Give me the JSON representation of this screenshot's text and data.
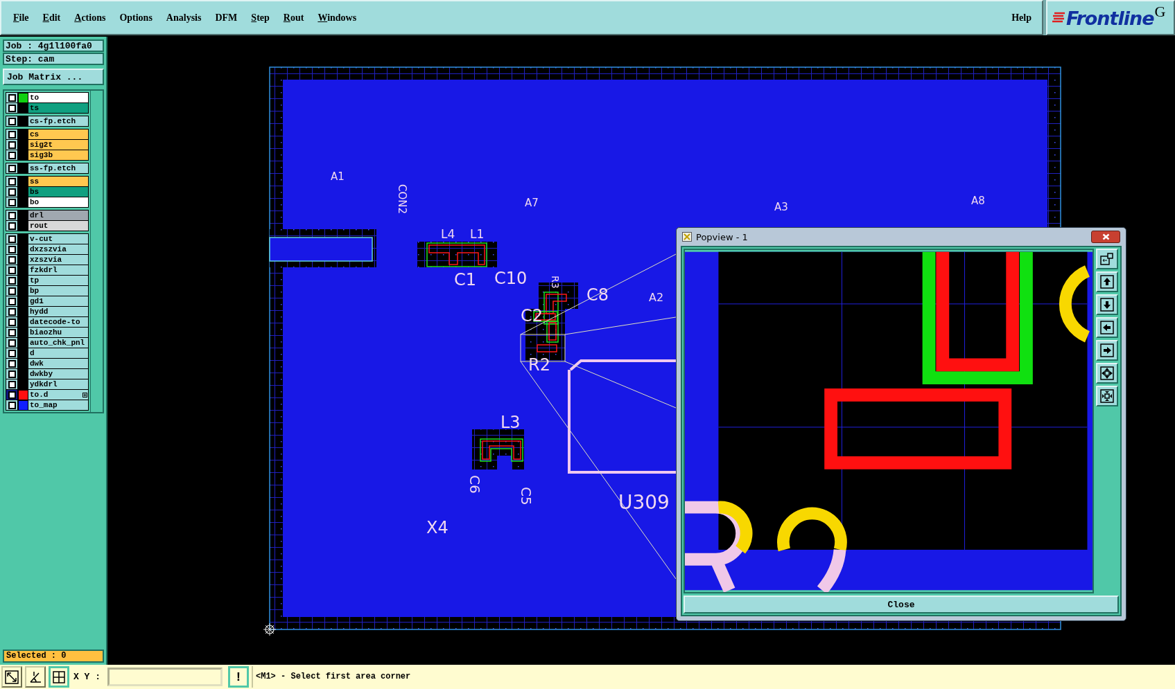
{
  "menu": [
    {
      "label": "File",
      "underlined": true
    },
    {
      "label": "Edit",
      "underlined": true
    },
    {
      "label": "Actions",
      "underlined": true
    },
    {
      "label": "Options",
      "underlined": false
    },
    {
      "label": "Analysis",
      "underlined": false
    },
    {
      "label": "DFM",
      "underlined": false
    },
    {
      "label": "Step",
      "underlined": true
    },
    {
      "label": "Rout",
      "underlined": true
    },
    {
      "label": "Windows",
      "underlined": true
    }
  ],
  "help": "Help",
  "logo": {
    "name": "Frontline",
    "suffix": "G"
  },
  "job": {
    "job": "Job : 4g1l100fa0",
    "step": "Step: cam",
    "matrix_button": "Job Matrix ..."
  },
  "layer_groups": [
    [
      {
        "name": "to",
        "color": "#ffffff",
        "swatch": {
          "color": "#10d010"
        },
        "selected": false
      },
      {
        "name": "ts",
        "color": "#10a080",
        "selected": false
      }
    ],
    [
      {
        "name": "cs-fp.etch",
        "color": "#a0dcdc",
        "selected": false
      }
    ],
    [
      {
        "name": "cs",
        "color": "#ffc850",
        "selected": false
      },
      {
        "name": "sig2t",
        "color": "#ffc850",
        "selected": false
      },
      {
        "name": "sig3b",
        "color": "#ffc850",
        "selected": false
      }
    ],
    [
      {
        "name": "ss-fp.etch",
        "color": "#a0dcdc",
        "selected": false
      }
    ],
    [
      {
        "name": "ss",
        "color": "#ffc850",
        "selected": false
      },
      {
        "name": "bs",
        "color": "#10a080",
        "selected": false
      },
      {
        "name": "bo",
        "color": "#ffffff",
        "selected": false
      }
    ],
    [
      {
        "name": "drl",
        "color": "#a0a8b0",
        "selected": false
      },
      {
        "name": "rout",
        "color": "#d8d8d8",
        "selected": false
      }
    ],
    [
      {
        "name": "v-cut",
        "color": "#a0dcdc",
        "selected": false
      },
      {
        "name": "dxzszvia",
        "color": "#a0dcdc",
        "selected": false
      },
      {
        "name": "xzszvia",
        "color": "#a0dcdc",
        "selected": false
      },
      {
        "name": "fzkdrl",
        "color": "#a0dcdc",
        "selected": false
      },
      {
        "name": "tp",
        "color": "#a0dcdc",
        "selected": false
      },
      {
        "name": "bp",
        "color": "#a0dcdc",
        "selected": false
      },
      {
        "name": "gd1",
        "color": "#a0dcdc",
        "selected": false
      },
      {
        "name": "hydd",
        "color": "#a0dcdc",
        "selected": false
      },
      {
        "name": "datecode-to",
        "color": "#a0dcdc",
        "selected": false
      },
      {
        "name": "biaozhu",
        "color": "#a0dcdc",
        "selected": false
      },
      {
        "name": "auto_chk_pnl",
        "color": "#a0dcdc",
        "selected": false
      },
      {
        "name": "d",
        "color": "#a0dcdc",
        "selected": false
      },
      {
        "name": "dwk",
        "color": "#a0dcdc",
        "selected": false
      },
      {
        "name": "dwkby",
        "color": "#a0dcdc",
        "selected": false
      },
      {
        "name": "ydkdrl",
        "color": "#a0dcdc",
        "selected": false
      },
      {
        "name": "to.d",
        "color": "#a0dcdc",
        "swatch": {
          "color": "#ff1010"
        },
        "selected": true
      },
      {
        "name": "to_map",
        "color": "#a0dcdc",
        "swatch": {
          "color": "#1020ff"
        },
        "selected": false
      }
    ]
  ],
  "selected_count": "Selected : 0",
  "board": {
    "labels": [
      {
        "text": "A1"
      },
      {
        "text": "CON2"
      },
      {
        "text": "A7"
      },
      {
        "text": "A3"
      },
      {
        "text": "A8"
      },
      {
        "text": "L4"
      },
      {
        "text": "L1"
      },
      {
        "text": "C1"
      },
      {
        "text": "C10"
      },
      {
        "text": "R3"
      },
      {
        "text": "C8"
      },
      {
        "text": "A2"
      },
      {
        "text": "C2"
      },
      {
        "text": "R2"
      },
      {
        "text": "L3"
      },
      {
        "text": "C6"
      },
      {
        "text": "C5"
      },
      {
        "text": "U309"
      },
      {
        "text": "X4"
      }
    ]
  },
  "popview": {
    "title": "Popview - 1",
    "close_button": "Close"
  },
  "command_bar": {
    "coord_label": "X Y :",
    "warn_button": "!",
    "prompt": "<M1> - Select first area corner"
  }
}
